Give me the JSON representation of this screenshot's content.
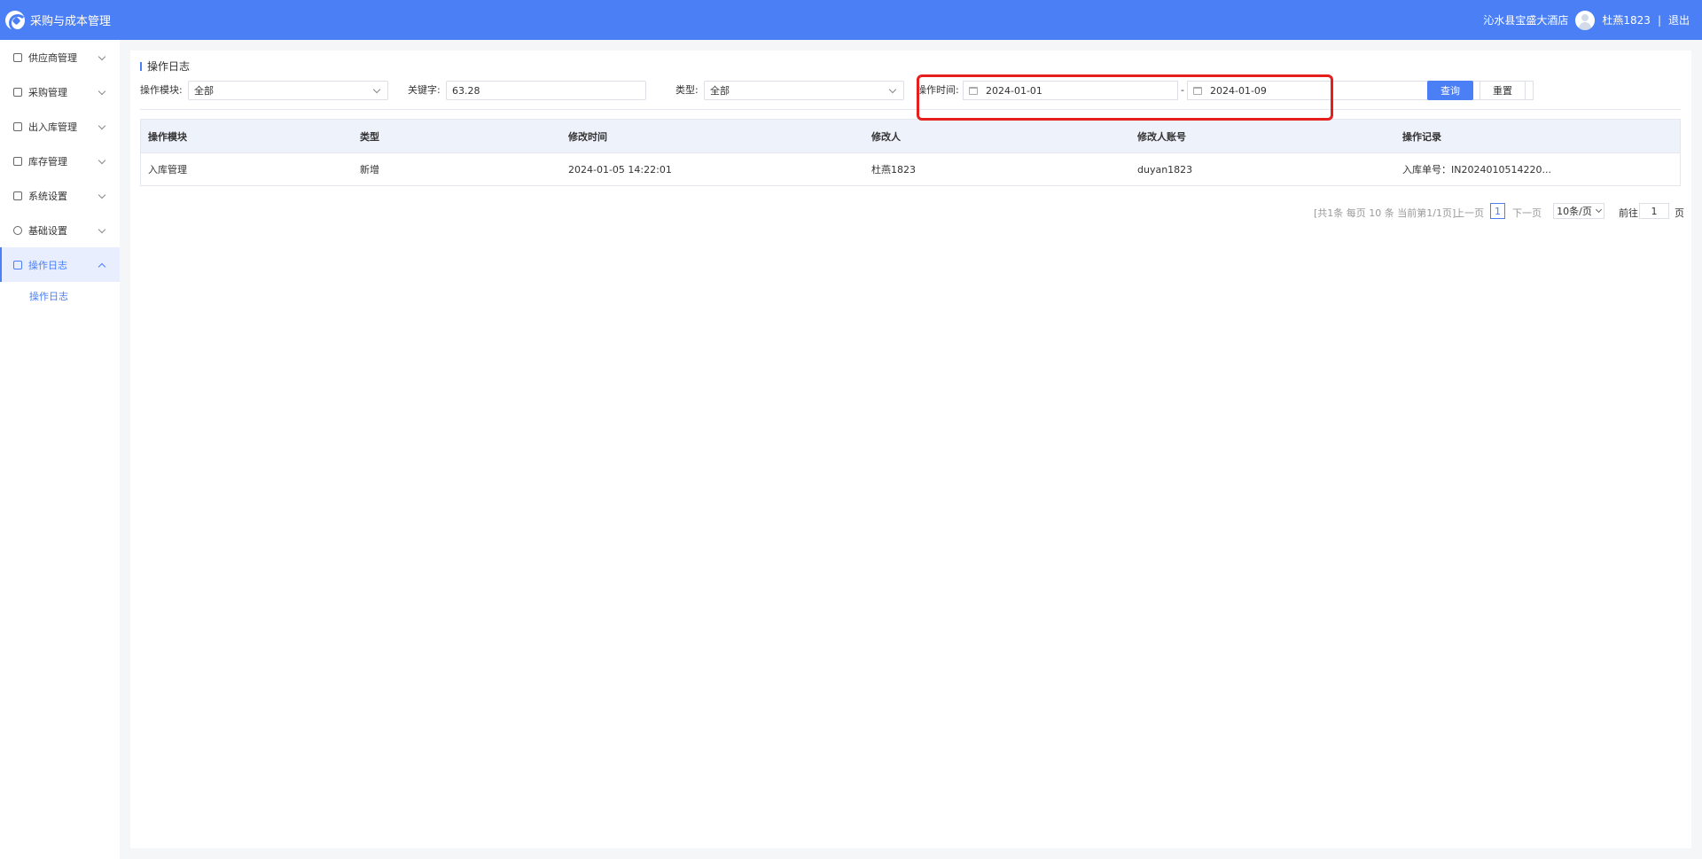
{
  "header": {
    "app_title": "采购与成本管理",
    "hotel_name": "沁水县宝盛大酒店",
    "user_name": "杜燕1823",
    "separator": "|",
    "logout_label": "退出"
  },
  "sidebar": {
    "items": [
      {
        "label": "供应商管理",
        "icon": "supplier-icon"
      },
      {
        "label": "采购管理",
        "icon": "cart-icon"
      },
      {
        "label": "出入库管理",
        "icon": "inout-icon"
      },
      {
        "label": "库存管理",
        "icon": "inventory-icon"
      },
      {
        "label": "系统设置",
        "icon": "settings-icon"
      },
      {
        "label": "基础设置",
        "icon": "gear-icon"
      },
      {
        "label": "操作日志",
        "icon": "log-icon",
        "active": true
      }
    ],
    "submenu": [
      {
        "label": "操作日志"
      }
    ]
  },
  "page": {
    "title": "操作日志"
  },
  "filters": {
    "module_label": "操作模块:",
    "module_value": "全部",
    "keyword_label": "关键字:",
    "keyword_value": "63.28",
    "type_label": "类型:",
    "type_value": "全部",
    "time_label": "操作时间:",
    "start_date": "2024-01-01",
    "date_separator": "-",
    "end_date": "2024-01-09",
    "query_label": "查询",
    "reset_label": "重置"
  },
  "table": {
    "columns": [
      "操作模块",
      "类型",
      "修改时间",
      "修改人",
      "修改人账号",
      "操作记录"
    ],
    "rows": [
      [
        "入库管理",
        "新增",
        "2024-01-05 14:22:01",
        "杜燕1823",
        "duyan1823",
        "入库单号：IN2024010514220..."
      ]
    ]
  },
  "pagination": {
    "summary": "[共1条 每页 10 条 当前第1/1页]",
    "prev_label": "上一页",
    "current_page": "1",
    "next_label": "下一页",
    "page_size": "10条/页",
    "goto_label": "前往",
    "goto_value": "1",
    "page_suffix": "页"
  },
  "colors": {
    "primary": "#4b7ff5",
    "highlight": "#e61e1e"
  }
}
